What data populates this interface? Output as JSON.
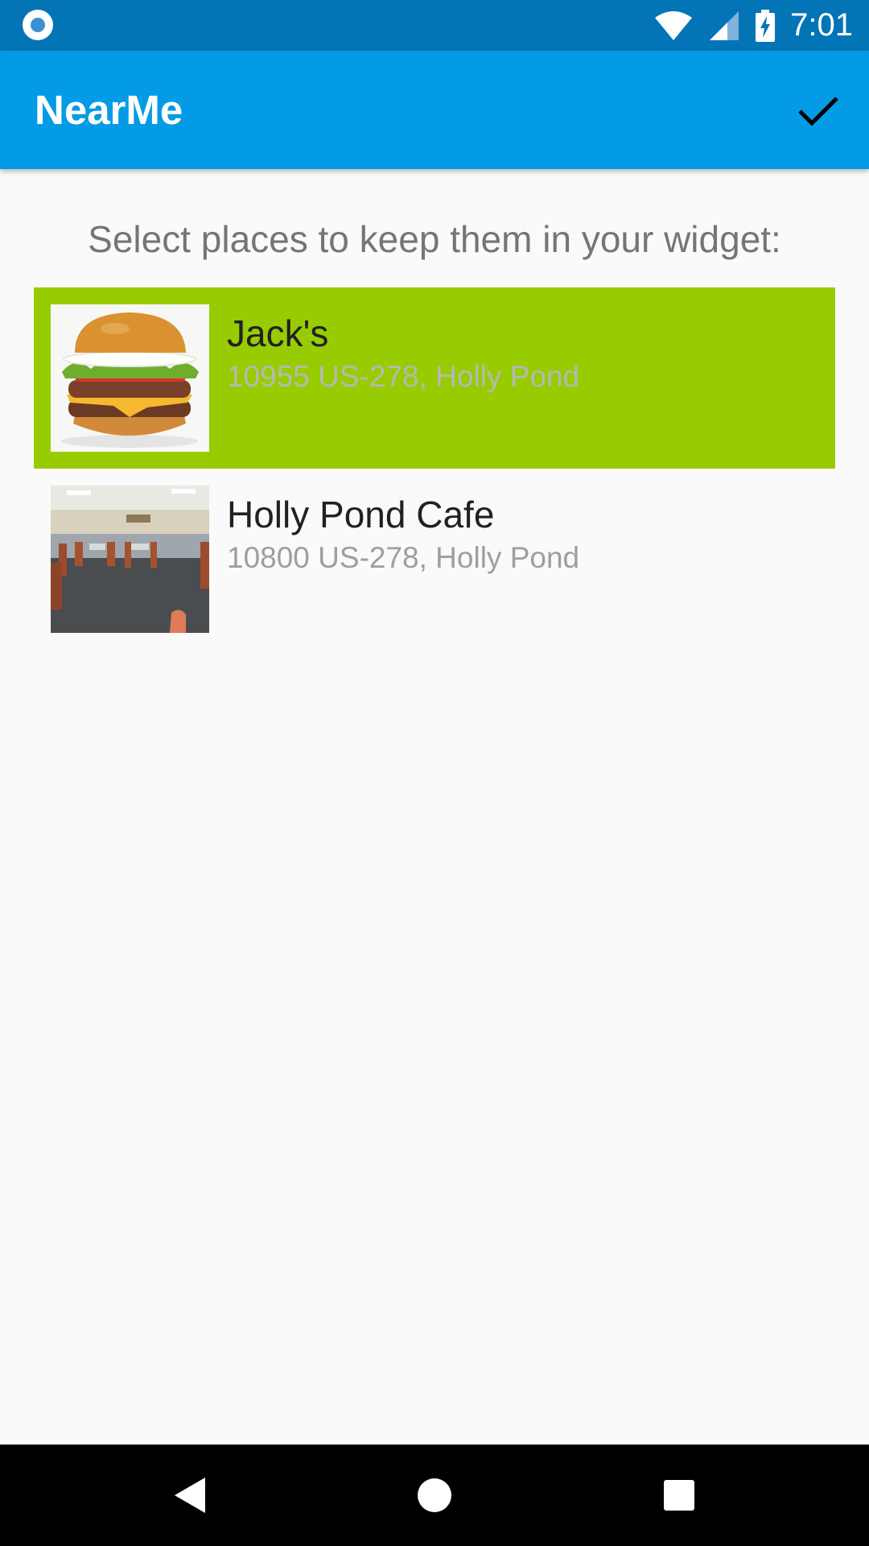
{
  "status_bar": {
    "time": "7:01",
    "icons": [
      "notification-icon",
      "wifi-icon",
      "signal-icon",
      "battery-charging-icon"
    ]
  },
  "app_bar": {
    "title": "NearMe",
    "confirm_icon": "check-icon",
    "color": "#039BE5"
  },
  "prompt": "Select places to keep them in your widget:",
  "places": [
    {
      "name": "Jack's",
      "address": "10955 US-278, Holly Pond",
      "selected": true,
      "thumbnail": "burger-photo"
    },
    {
      "name": "Holly Pond Cafe",
      "address": "10800 US-278, Holly Pond",
      "selected": false,
      "thumbnail": "restaurant-interior-photo"
    }
  ],
  "colors": {
    "status_bar": "#0374B5",
    "selected_item": "#99CC00",
    "background": "#FAFAFA"
  },
  "nav_bar": {
    "icons": [
      "back-icon",
      "home-icon",
      "recents-icon"
    ]
  }
}
